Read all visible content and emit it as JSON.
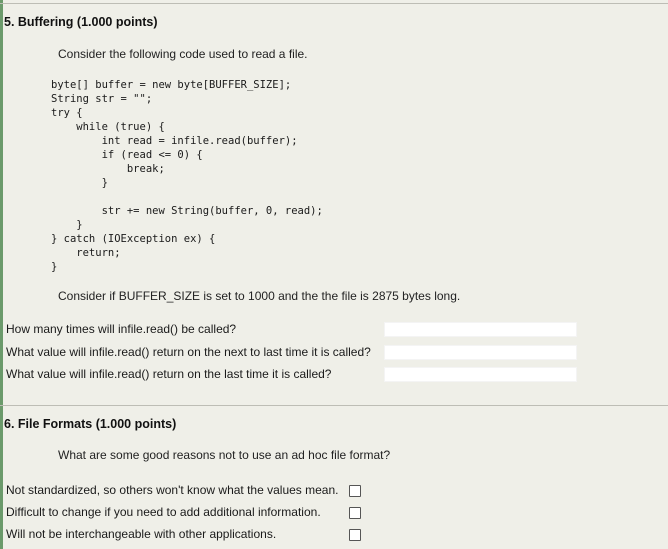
{
  "q5": {
    "title": "5. Buffering (1.000 points)",
    "intro": "Consider the following code used to read a file.",
    "code": "byte[] buffer = new byte[BUFFER_SIZE];\nString str = \"\";\ntry {\n    while (true) {\n        int read = infile.read(buffer);\n        if (read <= 0) {\n            break;\n        }\n\n        str += new String(buffer, 0, read);\n    }\n} catch (IOException ex) {\n    return;\n}",
    "condition": "Consider if BUFFER_SIZE is set to 1000 and the the file is 2875 bytes long.",
    "questions": [
      {
        "label": "How many times will infile.read() be called?",
        "value": ""
      },
      {
        "label": "What value will infile.read() return on the next to last time it is called?",
        "value": ""
      },
      {
        "label": "What value will infile.read() return on the last time it is called?",
        "value": ""
      }
    ]
  },
  "q6": {
    "title": "6. File Formats (1.000 points)",
    "intro": "What are some good reasons not to use an ad hoc file format?",
    "options": [
      {
        "label": "Not standardized, so others won't know what the values mean.",
        "checked": false
      },
      {
        "label": "Difficult to change if you need to add additional information.",
        "checked": false
      },
      {
        "label": "Will not be interchangeable with other applications.",
        "checked": false
      }
    ]
  }
}
